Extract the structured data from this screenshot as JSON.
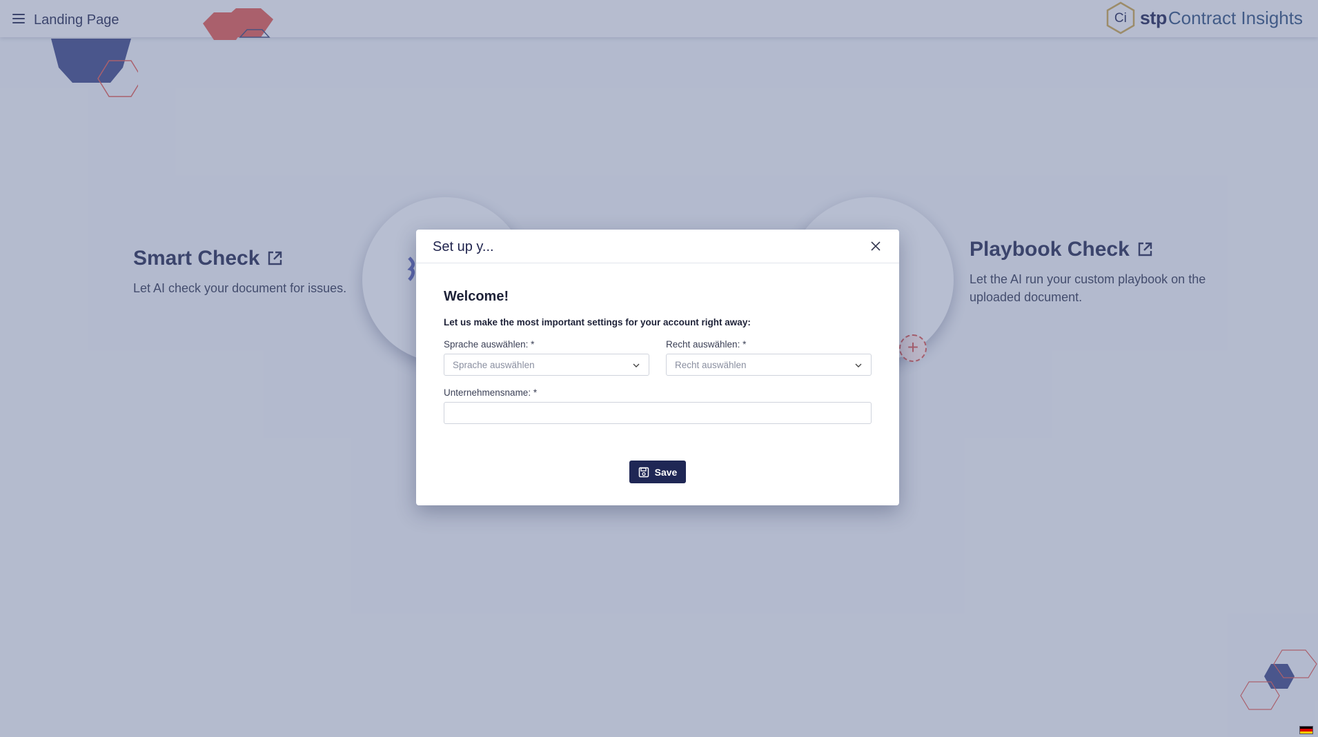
{
  "header": {
    "menu_icon": "hamburger-menu-icon",
    "title": "Landing Page",
    "brand": {
      "logo_text": "Ci",
      "stp": "stp",
      "name": "Contract Insights"
    }
  },
  "features": {
    "smart_check": {
      "title": "Smart Check",
      "description": "Let AI check your document for issues.",
      "icon": "external-link-icon"
    },
    "playbook_check": {
      "title": "Playbook Check",
      "description": "Let the AI run your custom playbook on the uploaded document.",
      "icon": "external-link-icon"
    }
  },
  "modal": {
    "title": "Set up y...",
    "welcome": "Welcome!",
    "intro": "Let us make the most important settings for your account right away:",
    "language": {
      "label": "Sprache auswählen: *",
      "placeholder": "Sprache auswählen"
    },
    "law": {
      "label": "Recht auswählen: *",
      "placeholder": "Recht auswählen"
    },
    "company": {
      "label": "Unternehmensname: *",
      "value": ""
    },
    "save_label": "Save"
  },
  "colors": {
    "brand_navy": "#1f2755",
    "accent_red": "#d9534f",
    "brand_gold": "#c9a24a"
  },
  "locale_flag": "de-flag-icon"
}
